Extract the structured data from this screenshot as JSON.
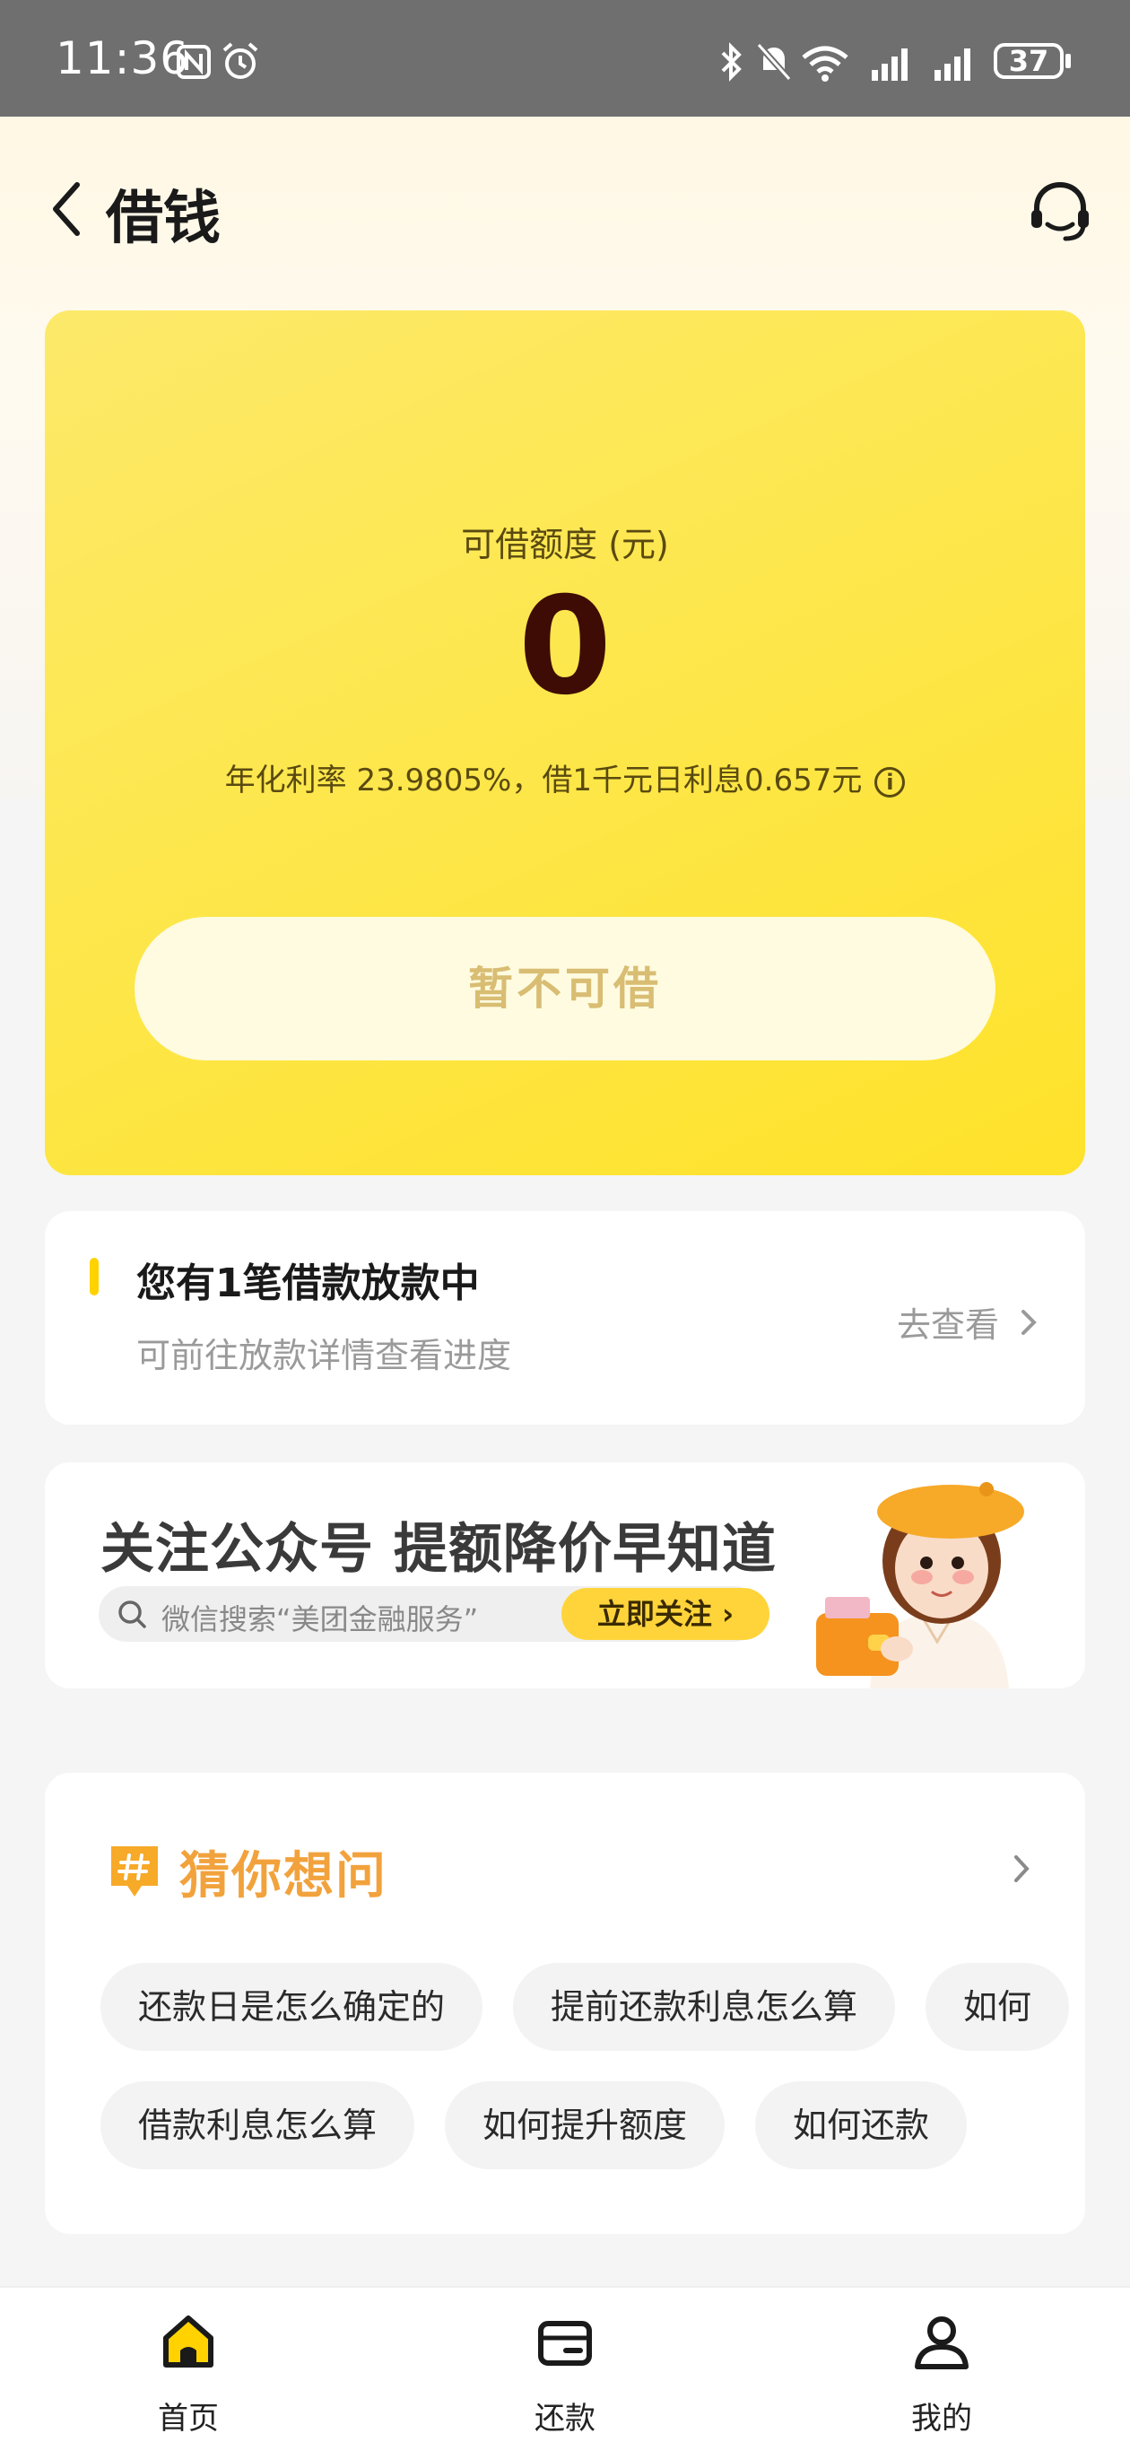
{
  "status_bar": {
    "time": "11:36",
    "battery": "37"
  },
  "header": {
    "title": "借钱"
  },
  "credit_card": {
    "label": "可借额度 (元)",
    "amount": "0",
    "rate_text": "年化利率 23.9805%，借1千元日利息0.657元",
    "button": "暂不可借"
  },
  "loan_notice": {
    "title": "您有1笔借款放款中",
    "subtitle": "可前往放款详情查看进度",
    "link": "去查看"
  },
  "banner": {
    "title": "关注公众号 提额降价早知道",
    "search_text": "微信搜索“美团金融服务”",
    "follow_button": "立即关注 ›"
  },
  "faq": {
    "title": "猜你想问",
    "row1": [
      "还款日是怎么确定的",
      "提前还款利息怎么算",
      "如何"
    ],
    "row2": [
      "借款利息怎么算",
      "如何提升额度",
      "如何还款"
    ]
  },
  "bottom_nav": {
    "items": [
      {
        "label": "首页",
        "icon": "home-icon",
        "active": true
      },
      {
        "label": "还款",
        "icon": "wallet-icon",
        "active": false
      },
      {
        "label": "我的",
        "icon": "profile-icon",
        "active": false
      }
    ]
  },
  "colors": {
    "brand_yellow": "#ffd200",
    "faq_title": "#f2a23c",
    "amount": "#3f0c05"
  }
}
